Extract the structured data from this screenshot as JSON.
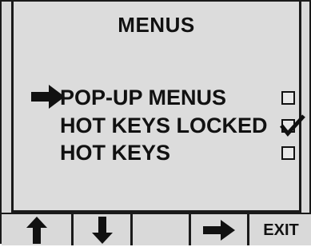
{
  "screen": {
    "title": "MENUS",
    "selected_index": 0,
    "items": [
      {
        "label": "POP-UP MENUS",
        "checked": false
      },
      {
        "label": "HOT KEYS LOCKED",
        "checked": true
      },
      {
        "label": "HOT KEYS",
        "checked": false
      }
    ]
  },
  "softkeys": [
    {
      "icon": "up-arrow-icon",
      "label": ""
    },
    {
      "icon": "down-arrow-icon",
      "label": ""
    },
    {
      "icon": "",
      "label": ""
    },
    {
      "icon": "right-arrow-icon",
      "label": ""
    },
    {
      "icon": "",
      "label": "EXIT"
    }
  ],
  "colors": {
    "background": "#dcdcdc",
    "text": "#111111"
  }
}
